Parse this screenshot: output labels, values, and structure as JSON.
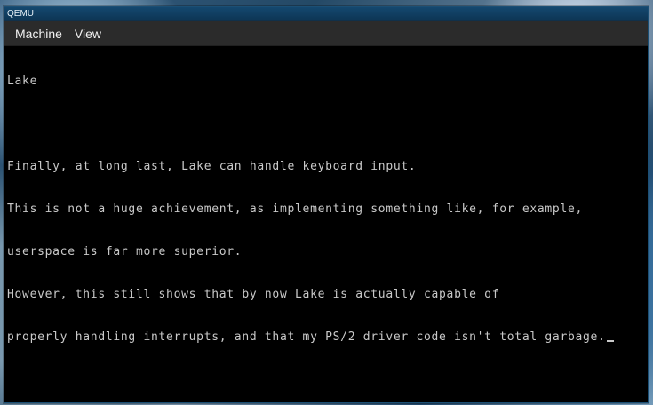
{
  "window": {
    "title": "QEMU"
  },
  "menubar": {
    "items": [
      {
        "label": "Machine"
      },
      {
        "label": "View"
      }
    ]
  },
  "terminal": {
    "lines": [
      "Lake",
      "",
      "Finally, at long last, Lake can handle keyboard input.",
      "This is not a huge achievement, as implementing something like, for example,",
      "userspace is far more superior.",
      "However, this still shows that by now Lake is actually capable of",
      "properly handling interrupts, and that my PS/2 driver code isn't total garbage."
    ]
  }
}
